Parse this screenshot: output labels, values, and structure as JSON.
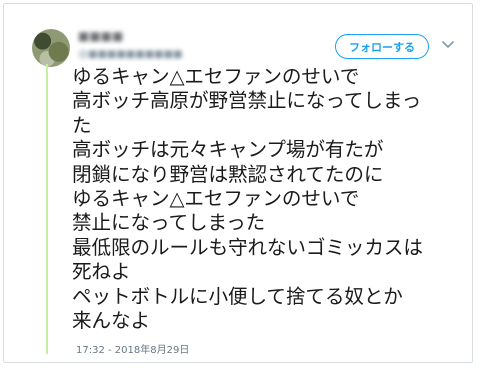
{
  "tweet": {
    "user": {
      "display_name": "■■■■",
      "handle": "@■■■■■■■■■■"
    },
    "follow_label": "フォローする",
    "text_lines": [
      "ゆるキャン△エセファンのせいで",
      "高ボッチ高原が野営禁止になってしまっ",
      "た",
      "高ボッチは元々キャンプ場が有たが",
      "閉鎖になり野営は黙認されてたのに",
      "ゆるキャン△エセファンのせいで",
      "禁止になってしまった",
      "最低限のルールも守れないゴミッカスは",
      "死ねよ",
      "ペットボトルに小便して捨てる奴とか",
      "来んなよ"
    ],
    "timestamp": "17:32 - 2018年8月29日"
  },
  "icons": {
    "avatar": "user-avatar",
    "more": "chevron-down-icon"
  },
  "colors": {
    "accent": "#1da1f2",
    "border": "#d8dde2",
    "thread_line": "#c7eea9"
  }
}
